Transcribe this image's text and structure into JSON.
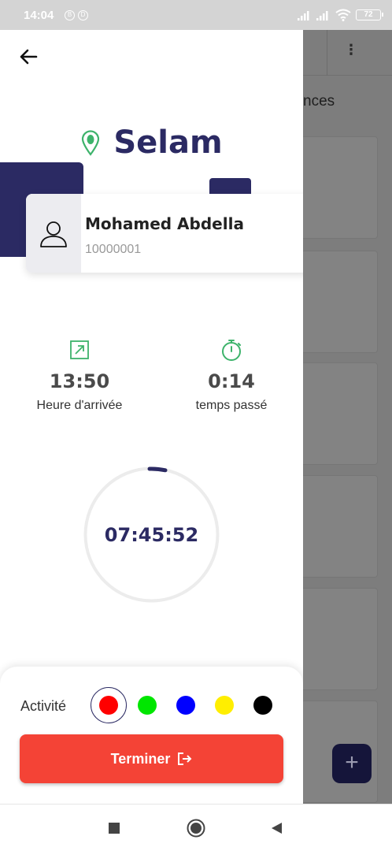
{
  "status_bar": {
    "time": "14:04",
    "notification_icons": [
      "B",
      "D"
    ],
    "battery_level": "72",
    "icons": [
      "signal-icon",
      "signal-icon",
      "wifi-icon",
      "battery-icon"
    ]
  },
  "background_app": {
    "tab_label_partial": "nces",
    "icons": [
      "kebab-menu-icon",
      "plus-icon"
    ]
  },
  "drawer": {
    "brand": {
      "title": "Selam",
      "icon": "location-pin-icon",
      "icon_color": "#3db36b"
    },
    "user": {
      "name": "Mohamed Abdella",
      "id": "10000001"
    },
    "stats": [
      {
        "value": "13:50",
        "label": "Heure d'arrivée",
        "icon": "arrival-arrow-icon"
      },
      {
        "value": "0:14",
        "label": "temps passé",
        "icon": "stopwatch-icon"
      }
    ],
    "timer": {
      "value": "07:45:52"
    },
    "activity": {
      "label": "Activité",
      "colors": [
        "#ff0000",
        "#00e600",
        "#0000ff",
        "#ffee00",
        "#000000"
      ],
      "selected": "#ff0000"
    },
    "finish_button": {
      "label": "Terminer",
      "icon": "logout-icon"
    }
  },
  "nav_bar": {
    "icons": [
      "recent-apps-icon",
      "home-icon",
      "back-icon"
    ]
  },
  "colors": {
    "primary": "#2b2a63",
    "accent_red": "#f44336",
    "green": "#3db36b"
  }
}
